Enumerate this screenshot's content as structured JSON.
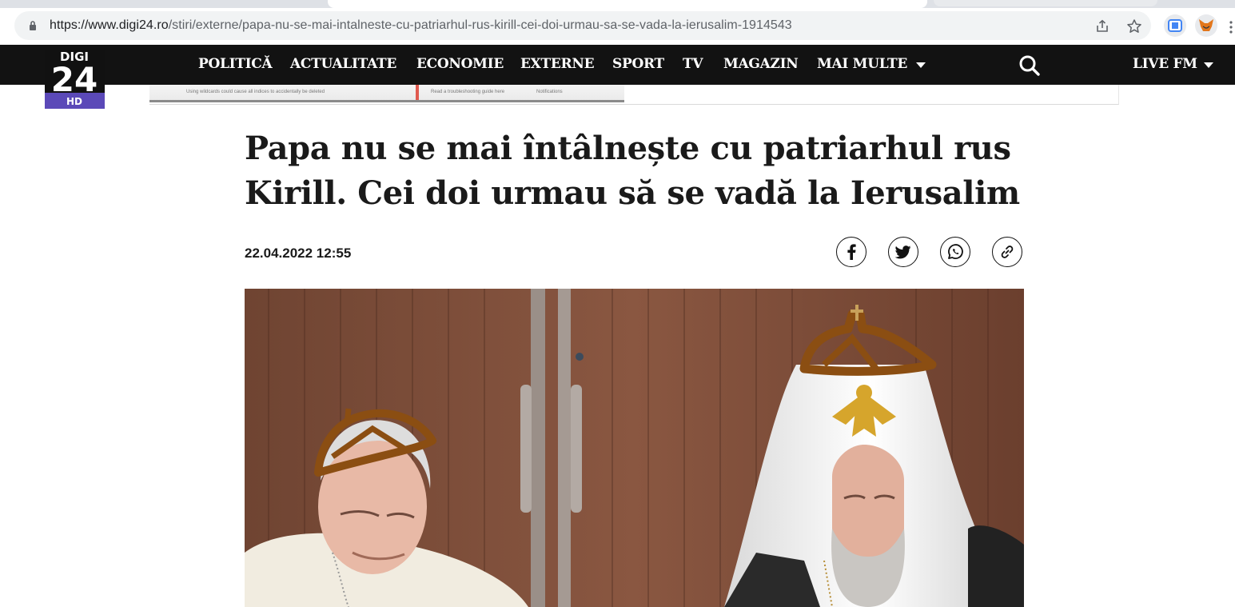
{
  "browser": {
    "url_host": "https://www.digi24.ro",
    "url_path": "/stiri/externe/papa-nu-se-mai-intalneste-cu-patriarhul-rus-kirill-cei-doi-urmau-sa-se-vada-la-ierusalim-1914543"
  },
  "site": {
    "logo_top": "DIGI",
    "logo_main": "24",
    "logo_badge": "HD",
    "nav": [
      "POLITICĂ",
      "ACTUALITATE",
      "ECONOMIE",
      "EXTERNE",
      "SPORT",
      "TV",
      "MAGAZIN",
      "MAI MULTE"
    ],
    "live": "LIVE FM"
  },
  "ad": {
    "text_left": "Using wildcards could cause all indices to accidentally be deleted",
    "text_mid": "Read a troubleshooting guide here",
    "text_right": "Notifications"
  },
  "article": {
    "title": "Papa nu se mai întâlnește cu patriarhul rus Kirill. Cei doi urmau să se vadă la Ierusalim",
    "date": "22.04.2022 12:55"
  },
  "icons": {
    "share": [
      "facebook-icon",
      "twitter-icon",
      "whatsapp-icon",
      "link-icon"
    ]
  },
  "colors": {
    "nav_bg": "#121212",
    "logo_badge": "#5b49b8",
    "photo_wall": "#7a4a35"
  }
}
